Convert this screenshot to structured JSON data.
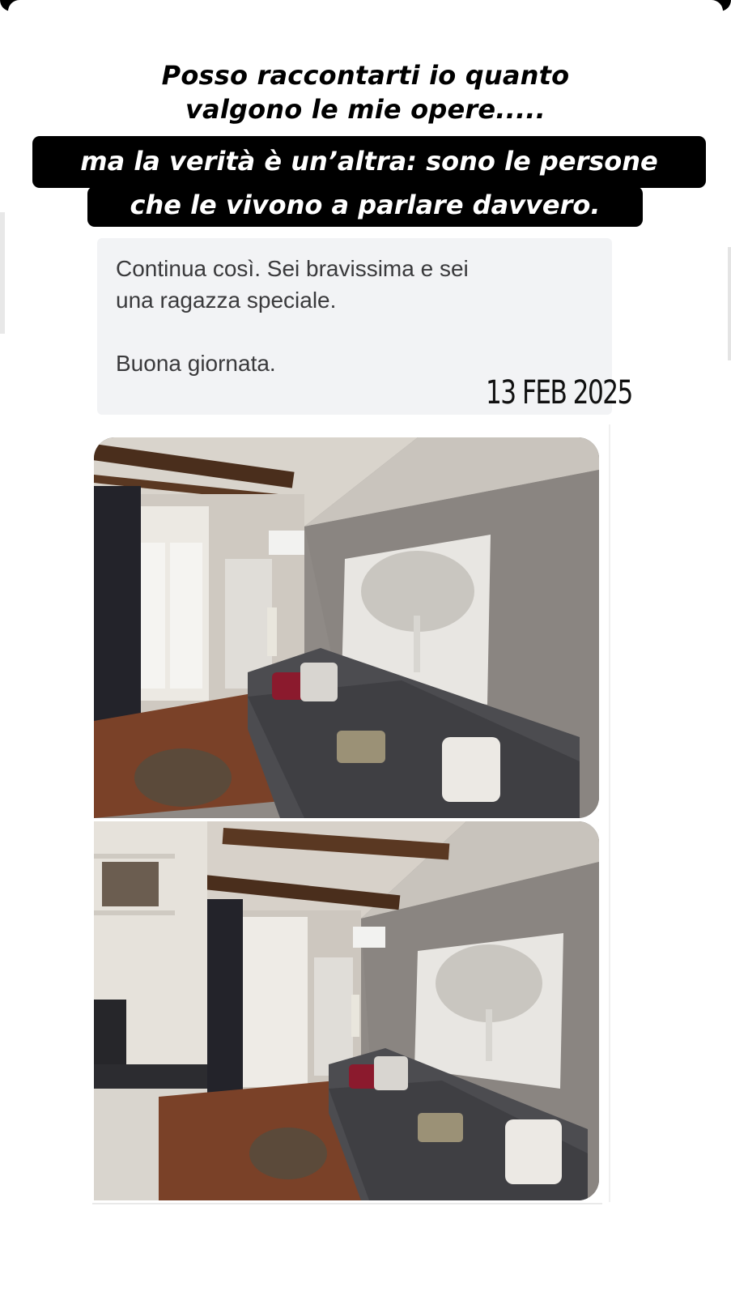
{
  "story": {
    "headline_lines": [
      "Posso raccontarti io quanto",
      "valgono le mie opere....."
    ],
    "highlight_lines": [
      "ma la verità è un’altra: sono le persone",
      "che le vivono a parlare davvero."
    ]
  },
  "message": {
    "line1": "Continua così. Sei bravissima e sei",
    "line2": "una ragazza speciale.",
    "line3": "Buona giornata.",
    "date": "13 FEB 2025"
  },
  "photos": [
    {
      "subject": "living-room-photo"
    },
    {
      "subject": "living-room-photo-wide"
    }
  ],
  "colors": {
    "highlight_bg": "#000000",
    "highlight_text": "#ffffff",
    "card_bg": "#f2f3f5",
    "wall": "#8c8784",
    "floor": "#7a4128",
    "sofa": "#4c4c50",
    "painting": "#e8e6e2"
  }
}
